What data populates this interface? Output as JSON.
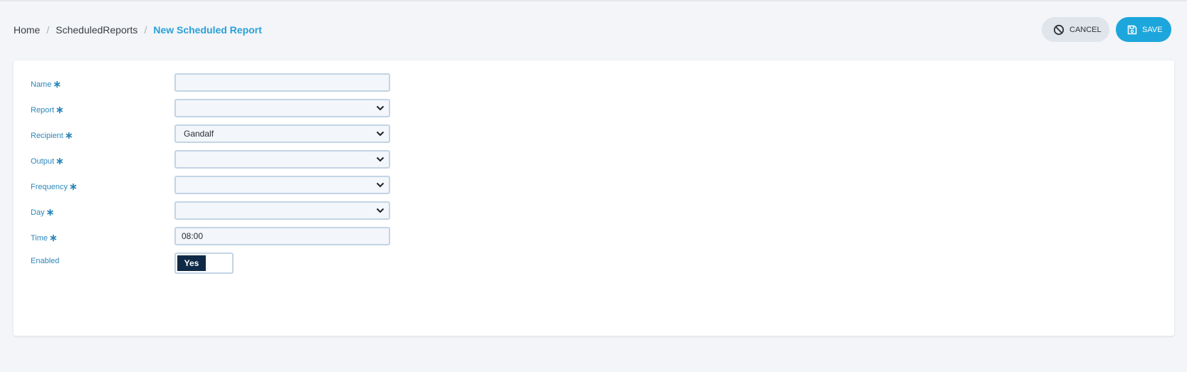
{
  "breadcrumb": {
    "home": "Home",
    "section": "ScheduledReports",
    "current": "New Scheduled Report",
    "separator": "/"
  },
  "actions": {
    "cancel_label": "CANCEL",
    "cancel_icon": "cancel-circle-icon",
    "save_label": "SAVE",
    "save_icon": "floppy-disk-icon"
  },
  "form": {
    "required_mark": "∗",
    "name": {
      "label": "Name",
      "value": ""
    },
    "report": {
      "label": "Report",
      "value": ""
    },
    "recipient": {
      "label": "Recipient",
      "value": "Gandalf"
    },
    "output": {
      "label": "Output",
      "value": ""
    },
    "frequency": {
      "label": "Frequency",
      "value": ""
    },
    "day": {
      "label": "Day",
      "value": ""
    },
    "time": {
      "label": "Time",
      "value": "08:00"
    },
    "enabled": {
      "label": "Enabled",
      "value": "Yes"
    }
  },
  "colors": {
    "accent": "#1ca6dc",
    "label": "#2c87b9",
    "toggle_on": "#0f2a47"
  }
}
